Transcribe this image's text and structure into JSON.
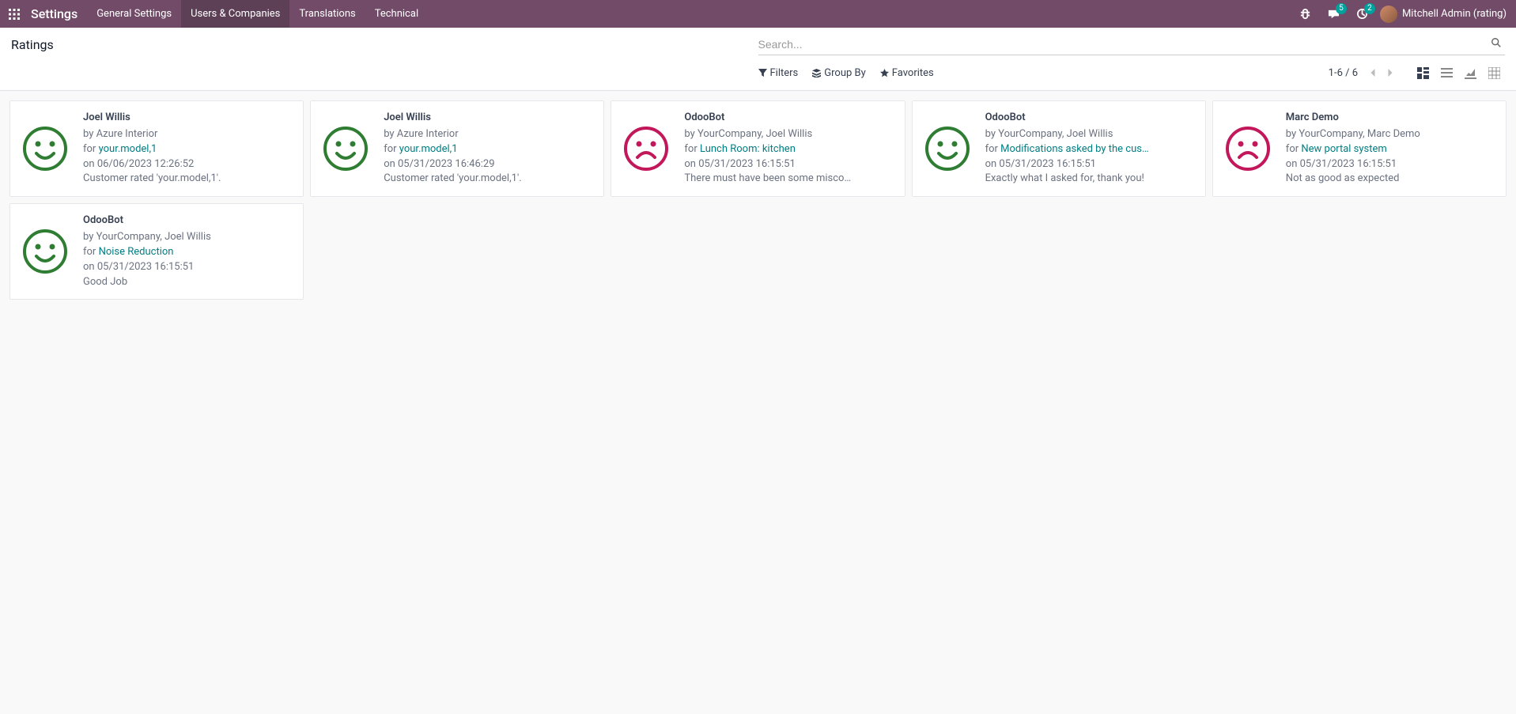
{
  "app_title": "Settings",
  "nav": {
    "items": [
      {
        "label": "General Settings",
        "active": false
      },
      {
        "label": "Users & Companies",
        "active": true
      },
      {
        "label": "Translations",
        "active": false
      },
      {
        "label": "Technical",
        "active": false
      }
    ]
  },
  "tray": {
    "messages_badge": "5",
    "activities_badge": "2"
  },
  "user": {
    "name": "Mitchell Admin (rating)"
  },
  "breadcrumb": "Ratings",
  "search": {
    "placeholder": "Search..."
  },
  "search_options": {
    "filters": "Filters",
    "groupby": "Group By",
    "favorites": "Favorites"
  },
  "pager": {
    "text": "1-6 / 6"
  },
  "ratings": [
    {
      "title": "Joel Willis",
      "by": "by Azure Interior",
      "for_prefix": "for ",
      "for_link": "your.model,1",
      "on": "on 06/06/2023 12:26:52",
      "feedback": "Customer rated 'your.model,1'.",
      "mood": "happy"
    },
    {
      "title": "Joel Willis",
      "by": "by Azure Interior",
      "for_prefix": "for ",
      "for_link": "your.model,1",
      "on": "on 05/31/2023 16:46:29",
      "feedback": "Customer rated 'your.model,1'.",
      "mood": "happy"
    },
    {
      "title": "OdooBot",
      "by": "by YourCompany, Joel Willis",
      "for_prefix": "for ",
      "for_link": "Lunch Room: kitchen",
      "on": "on 05/31/2023 16:15:51",
      "feedback": "There must have been some misco…",
      "mood": "sad"
    },
    {
      "title": "OdooBot",
      "by": "by YourCompany, Joel Willis",
      "for_prefix": "for ",
      "for_link": "Modifications asked by the cus…",
      "on": "on 05/31/2023 16:15:51",
      "feedback": "Exactly what I asked for, thank you!",
      "mood": "happy"
    },
    {
      "title": "Marc Demo",
      "by": "by YourCompany, Marc Demo",
      "for_prefix": "for ",
      "for_link": "New portal system",
      "on": "on 05/31/2023 16:15:51",
      "feedback": "Not as good as expected",
      "mood": "sad"
    },
    {
      "title": "OdooBot",
      "by": "by YourCompany, Joel Willis",
      "for_prefix": "for ",
      "for_link": "Noise Reduction",
      "on": "on 05/31/2023 16:15:51",
      "feedback": "Good Job",
      "mood": "happy"
    }
  ]
}
